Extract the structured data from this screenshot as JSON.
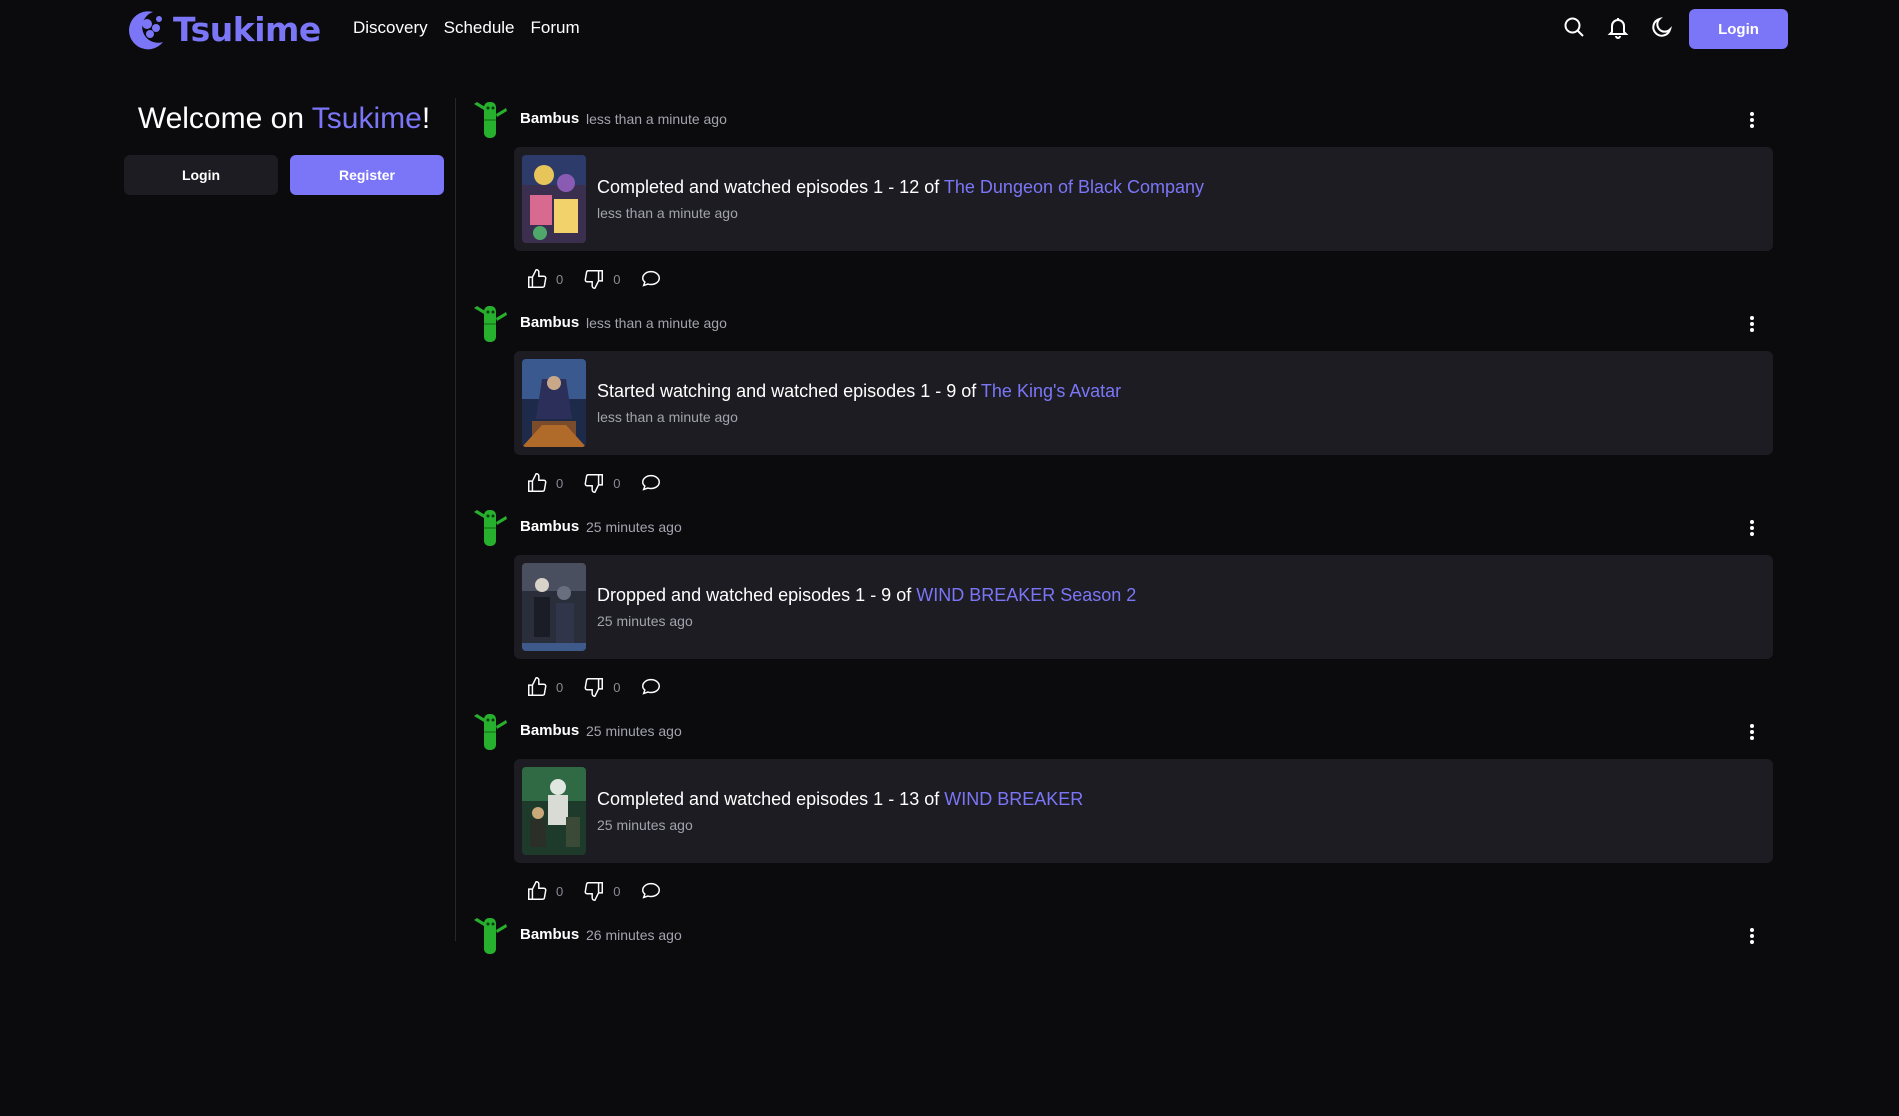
{
  "header": {
    "brand": "Tsukime",
    "nav": [
      {
        "label": "Discovery"
      },
      {
        "label": "Schedule"
      },
      {
        "label": "Forum"
      }
    ],
    "icons": [
      "search-icon",
      "bell-icon",
      "moon-icon"
    ],
    "login_label": "Login"
  },
  "sidebar": {
    "welcome_prefix": "Welcome on ",
    "welcome_brand": "Tsukime",
    "welcome_suffix": "!",
    "login_label": "Login",
    "register_label": "Register"
  },
  "colors": {
    "accent": "#7b76f7",
    "background": "#0b0b0e",
    "card": "#1c1c22",
    "muted_text": "#a3a3ad"
  },
  "feed": [
    {
      "user": "Bambus",
      "time": "less than a minute ago",
      "action": "Completed and watched episodes 1 - 12 of ",
      "title": "The Dungeon of Black Company",
      "card_time": "less than a minute ago",
      "likes": "0",
      "dislikes": "0"
    },
    {
      "user": "Bambus",
      "time": "less than a minute ago",
      "action": "Started watching and watched episodes 1 - 9 of ",
      "title": "The King's Avatar",
      "card_time": "less than a minute ago",
      "likes": "0",
      "dislikes": "0"
    },
    {
      "user": "Bambus",
      "time": "25 minutes ago",
      "action": "Dropped and watched episodes 1 - 9 of ",
      "title": "WIND BREAKER Season 2",
      "card_time": "25 minutes ago",
      "likes": "0",
      "dislikes": "0"
    },
    {
      "user": "Bambus",
      "time": "25 minutes ago",
      "action": "Completed and watched episodes 1 - 13 of ",
      "title": "WIND BREAKER",
      "card_time": "25 minutes ago",
      "likes": "0",
      "dislikes": "0"
    },
    {
      "user": "Bambus",
      "time": "26 minutes ago"
    }
  ]
}
